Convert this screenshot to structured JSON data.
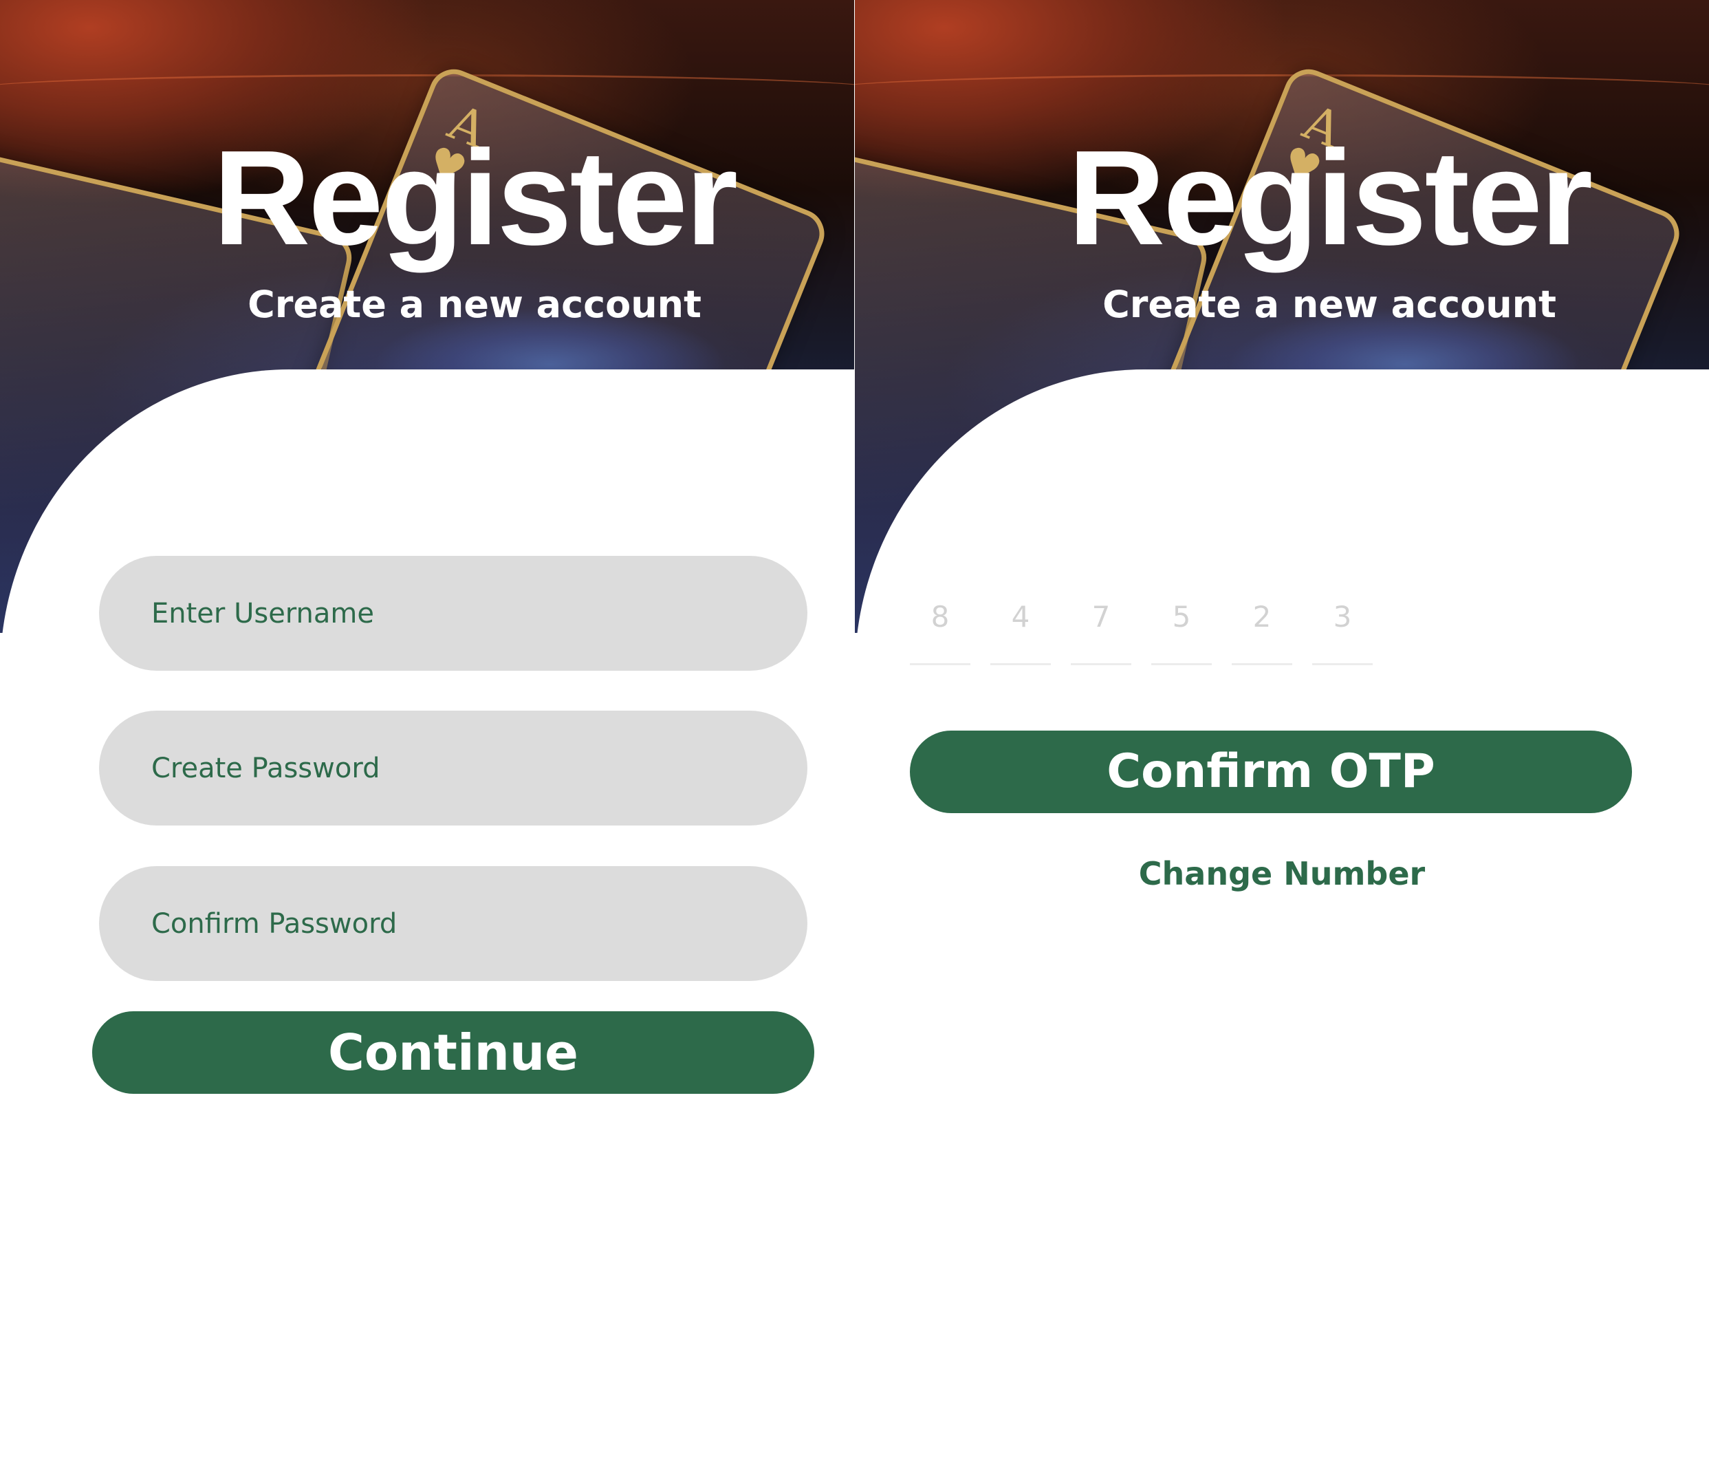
{
  "colors": {
    "accent_green": "#2d6a4a",
    "input_background": "#dcdcdc",
    "card_gold": "#c9a257"
  },
  "header": {
    "title": "Register",
    "subtitle": "Create a new account",
    "background_cards": [
      {
        "rank": "A",
        "suit_icon": "heart-icon",
        "suit_glyph": "♥"
      },
      {
        "rank": "A",
        "suit_icon": "heart-icon",
        "suit_glyph": "♥"
      }
    ]
  },
  "register_form": {
    "username_placeholder": "Enter Username",
    "password_placeholder": "Create Password",
    "confirm_password_placeholder": "Confirm Password",
    "continue_label": "Continue"
  },
  "otp_form": {
    "digits": [
      "8",
      "4",
      "7",
      "5",
      "2",
      "3"
    ],
    "confirm_label": "Confirm OTP",
    "change_number_label": "Change Number"
  }
}
